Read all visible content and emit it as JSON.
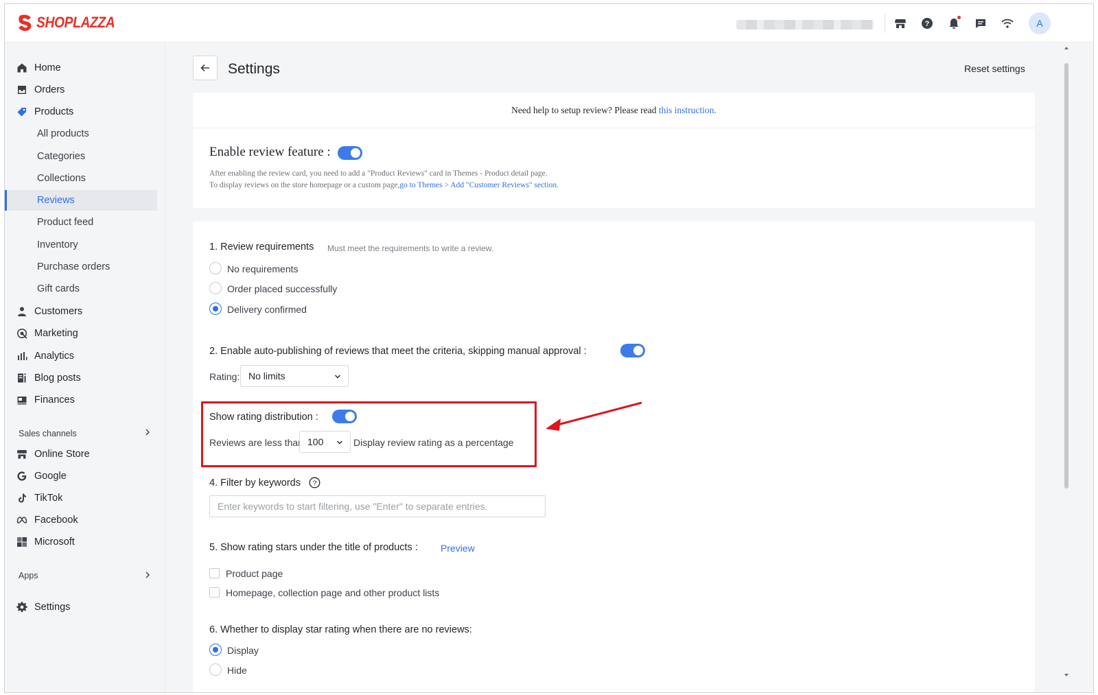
{
  "app": {
    "brand": "SHOPLAZZA",
    "brand_color": "#e63127",
    "accent_color": "#2f6fe5",
    "avatar_initial": "A"
  },
  "topbar": {
    "icons": [
      "store-icon",
      "help-icon",
      "bell-icon",
      "chat-icon",
      "wifi-icon"
    ]
  },
  "sidebar": {
    "items": [
      {
        "label": "Home",
        "icon": "home-icon"
      },
      {
        "label": "Orders",
        "icon": "orders-icon"
      },
      {
        "label": "Products",
        "icon": "tag-icon"
      },
      {
        "label": "All products"
      },
      {
        "label": "Categories"
      },
      {
        "label": "Collections"
      },
      {
        "label": "Reviews",
        "active": true
      },
      {
        "label": "Product feed"
      },
      {
        "label": "Inventory"
      },
      {
        "label": "Purchase orders"
      },
      {
        "label": "Gift cards"
      },
      {
        "label": "Customers",
        "icon": "person-icon"
      },
      {
        "label": "Marketing",
        "icon": "marketing-icon"
      },
      {
        "label": "Analytics",
        "icon": "bar-chart-icon"
      },
      {
        "label": "Blog posts",
        "icon": "blog-icon"
      },
      {
        "label": "Finances",
        "icon": "finance-icon"
      }
    ],
    "sales_channels_label": "Sales channels",
    "channels": [
      {
        "label": "Online Store",
        "icon": "store-icon"
      },
      {
        "label": "Google",
        "icon": "google-icon"
      },
      {
        "label": "TikTok",
        "icon": "tiktok-icon"
      },
      {
        "label": "Facebook",
        "icon": "meta-icon"
      },
      {
        "label": "Microsoft",
        "icon": "microsoft-icon"
      }
    ],
    "apps_label": "Apps",
    "settings_label": "Settings"
  },
  "header": {
    "title": "Settings",
    "reset_label": "Reset settings"
  },
  "help": {
    "text": "Need help to setup review? Please read ",
    "link": "this instruction."
  },
  "enable": {
    "title": "Enable review feature :",
    "enabled": true,
    "desc1": "After enabling the review card, you need to add a \"Product Reviews\" card in Themes - Product detail page.",
    "desc2_prefix": "To display reviews on the store homepage or a custom page,",
    "desc2_link": "go to Themes > Add \"Customer Reviews\" section."
  },
  "requirements": {
    "title": "1. Review requirements",
    "hint": "Must meet the requirements to write a review.",
    "options": [
      "No requirements",
      "Order placed successfully",
      "Delivery confirmed"
    ],
    "selected": "Delivery confirmed"
  },
  "auto_publish": {
    "title": "2. Enable auto-publishing of reviews that meet the criteria, skipping manual approval :",
    "enabled": true,
    "rating_label": "Rating:",
    "rating_value": "No limits"
  },
  "distribution": {
    "title": "Show rating distribution :",
    "enabled": true,
    "prefix": "Reviews are less than",
    "threshold": "100",
    "suffix": "Display review rating as a percentage"
  },
  "keywords": {
    "title": "4. Filter by keywords",
    "placeholder": "Enter keywords to start filtering, use \"Enter\" to separate entries."
  },
  "stars": {
    "title": "5. Show rating stars under the title of products :",
    "preview": "Preview",
    "options": [
      "Product page",
      "Homepage, collection page and other product lists"
    ]
  },
  "no_reviews": {
    "title": "6. Whether to display star rating when there are no reviews:",
    "options": [
      "Display",
      "Hide"
    ],
    "selected": "Display"
  },
  "annotation_color": "#e0141b"
}
